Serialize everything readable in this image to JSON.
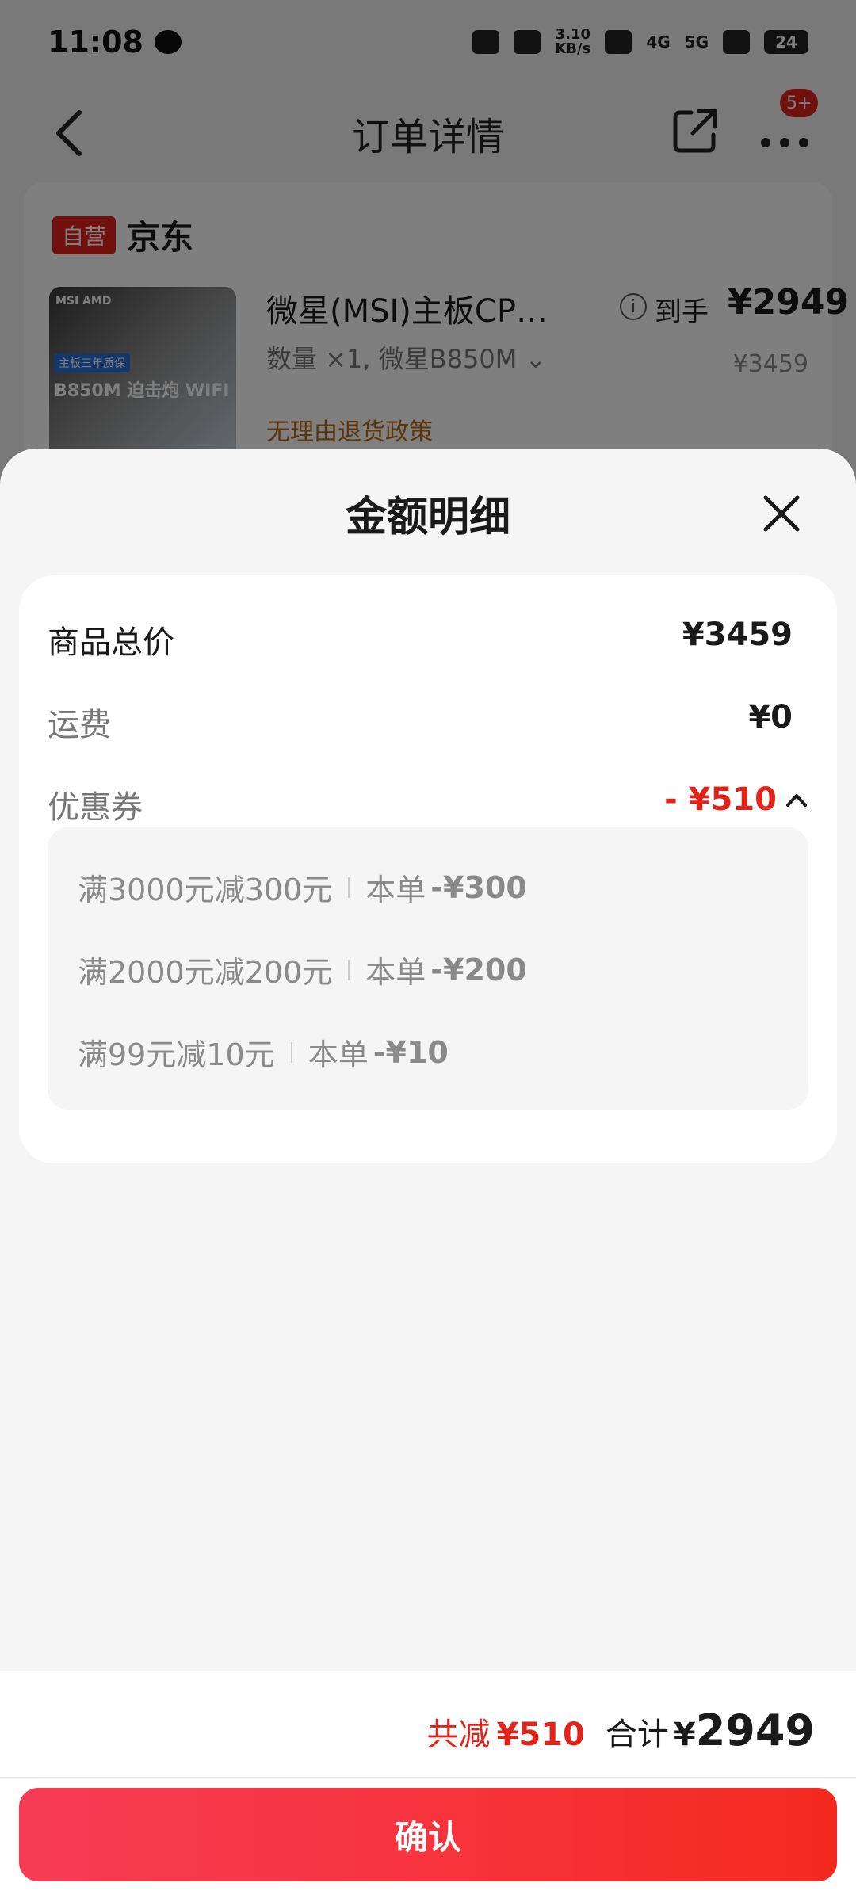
{
  "status_bar": {
    "time": "11:08",
    "speed_top": "3.10",
    "speed_bottom": "KB/s",
    "network1": "4G",
    "network2": "5G",
    "battery": "24"
  },
  "nav": {
    "title": "订单详情",
    "badge": "5+"
  },
  "shop": {
    "tag": "自营",
    "name": "京东"
  },
  "product": {
    "image_brand_text": "MSI AMD",
    "image_banner": "主板三年质保",
    "image_model": "B850M 迫击炮 WIFI",
    "title": "微星(MSI)主板CP…",
    "spec": "数量 ×1, 微星B850M ⌄",
    "policy": "无理由退货政策",
    "info_glyph": "i",
    "price_label": "到手",
    "price": "¥2949",
    "original_price": "¥3459"
  },
  "sheet": {
    "title": "金额明细",
    "rows": [
      {
        "label": "商品总价",
        "value": "¥3459"
      },
      {
        "label": "运费",
        "value": "¥0"
      },
      {
        "label": "优惠券",
        "value": "- ¥510"
      }
    ],
    "coupons": [
      {
        "rule": "满3000元减300元",
        "scope": "本单",
        "amount": "-¥300"
      },
      {
        "rule": "满2000元减200元",
        "scope": "本单",
        "amount": "-¥200"
      },
      {
        "rule": "满99元减10元",
        "scope": "本单",
        "amount": "-¥10"
      }
    ]
  },
  "footer": {
    "saved_label": "共减",
    "saved_amount": "¥510",
    "total_label": "合计",
    "total_currency": "¥",
    "total_amount": "2949",
    "confirm_label": "确认"
  },
  "colors": {
    "accent_red": "#e2231a",
    "button_gradient_start": "#f63c55",
    "button_gradient_end": "#f42a1e",
    "policy_orange": "#b8690f"
  }
}
